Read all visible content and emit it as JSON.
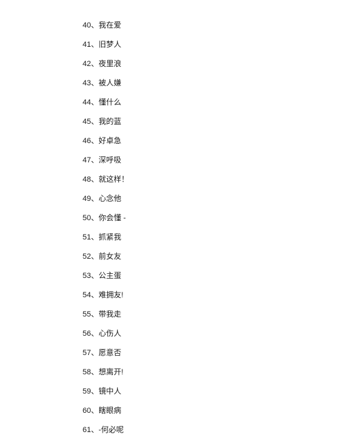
{
  "separator": "、",
  "items": [
    {
      "num": "40",
      "text": "我在爱"
    },
    {
      "num": "41",
      "text": "旧梦人"
    },
    {
      "num": "42",
      "text": "夜里浪"
    },
    {
      "num": "43",
      "text": "被人嫌"
    },
    {
      "num": "44",
      "text": "懂什么"
    },
    {
      "num": "45",
      "text": "我的蓝"
    },
    {
      "num": "46",
      "text": "好卓急"
    },
    {
      "num": "47",
      "text": "深呼吸"
    },
    {
      "num": "48",
      "text": "就这样！"
    },
    {
      "num": "49",
      "text": "心念他"
    },
    {
      "num": "50",
      "text": "你会懂 -"
    },
    {
      "num": "51",
      "text": "抓紧我"
    },
    {
      "num": "52",
      "text": "前女友"
    },
    {
      "num": "53",
      "text": "公主蛋"
    },
    {
      "num": "54",
      "text": "难拥友!"
    },
    {
      "num": "55",
      "text": "带我走"
    },
    {
      "num": "56",
      "text": "心伤人"
    },
    {
      "num": "57",
      "text": "愿意否"
    },
    {
      "num": "58",
      "text": "想离开!"
    },
    {
      "num": "59",
      "text": "镜中人"
    },
    {
      "num": "60",
      "text": "瞎眼病"
    },
    {
      "num": "61",
      "text": "-何必呢"
    }
  ]
}
